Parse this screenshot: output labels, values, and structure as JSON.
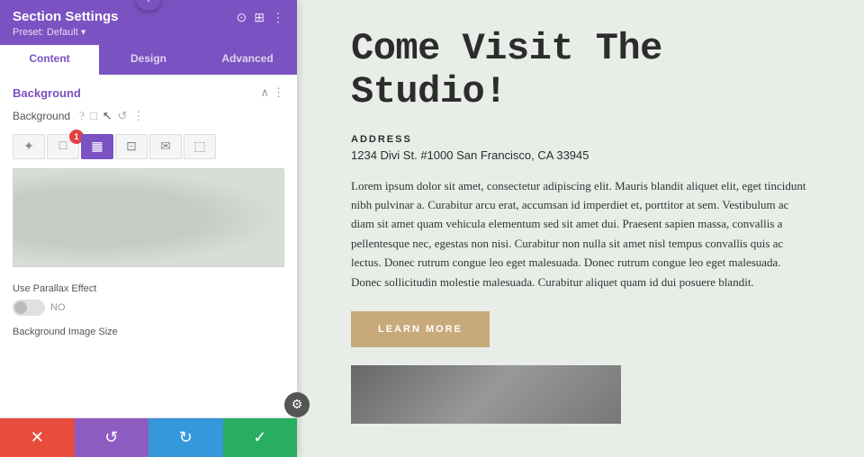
{
  "panel": {
    "plus_icon": "+",
    "header": {
      "title": "Section Settings",
      "preset": "Preset: Default ▾",
      "icons": [
        "⊙",
        "⊞",
        "⋮"
      ]
    },
    "tabs": [
      {
        "label": "Content",
        "active": true
      },
      {
        "label": "Design",
        "active": false
      },
      {
        "label": "Advanced",
        "active": false
      }
    ],
    "background_section": {
      "label": "Background",
      "collapse_icon": "∧",
      "more_icon": "⋮"
    },
    "background_row": {
      "label": "Background",
      "help_icon": "?",
      "copy_icon": "□",
      "arrow_icon": "↖",
      "reset_icon": "↺",
      "more_icon": "⋮"
    },
    "bg_type_buttons": [
      {
        "icon": "✦",
        "active": false,
        "badge": null
      },
      {
        "icon": "□",
        "active": false,
        "badge": "1"
      },
      {
        "icon": "▦",
        "active": true,
        "badge": null
      },
      {
        "icon": "⊡",
        "active": false,
        "badge": null
      },
      {
        "icon": "✉",
        "active": false,
        "badge": null
      },
      {
        "icon": "⬚",
        "active": false,
        "badge": null
      }
    ],
    "parallax": {
      "label": "Use Parallax Effect",
      "toggle_text": "NO"
    },
    "bg_image_size": {
      "label": "Background Image Size"
    },
    "footer": {
      "cancel_icon": "✕",
      "undo_icon": "↺",
      "redo_icon": "↻",
      "confirm_icon": "✓"
    },
    "gear_icon": "⚙"
  },
  "content": {
    "title": "Come Visit The Studio!",
    "address_label": "ADDRESS",
    "address": "1234 Divi St. #1000 San Francisco, CA 33945",
    "body_text": "Lorem ipsum dolor sit amet, consectetur adipiscing elit. Mauris blandit aliquet elit, eget tincidunt nibh pulvinar a. Curabitur arcu erat, accumsan id imperdiet et, porttitor at sem. Vestibulum ac diam sit amet quam vehicula elementum sed sit amet dui. Praesent sapien massa, convallis a pellentesque nec, egestas non nisi. Curabitur non nulla sit amet nisl tempus convallis quis ac lectus. Donec rutrum congue leo eget malesuada. Donec rutrum congue leo eget malesuada. Donec sollicitudin molestie malesuada. Curabitur aliquet quam id dui posuere blandit.",
    "learn_more_button": "LEARN MORE"
  }
}
